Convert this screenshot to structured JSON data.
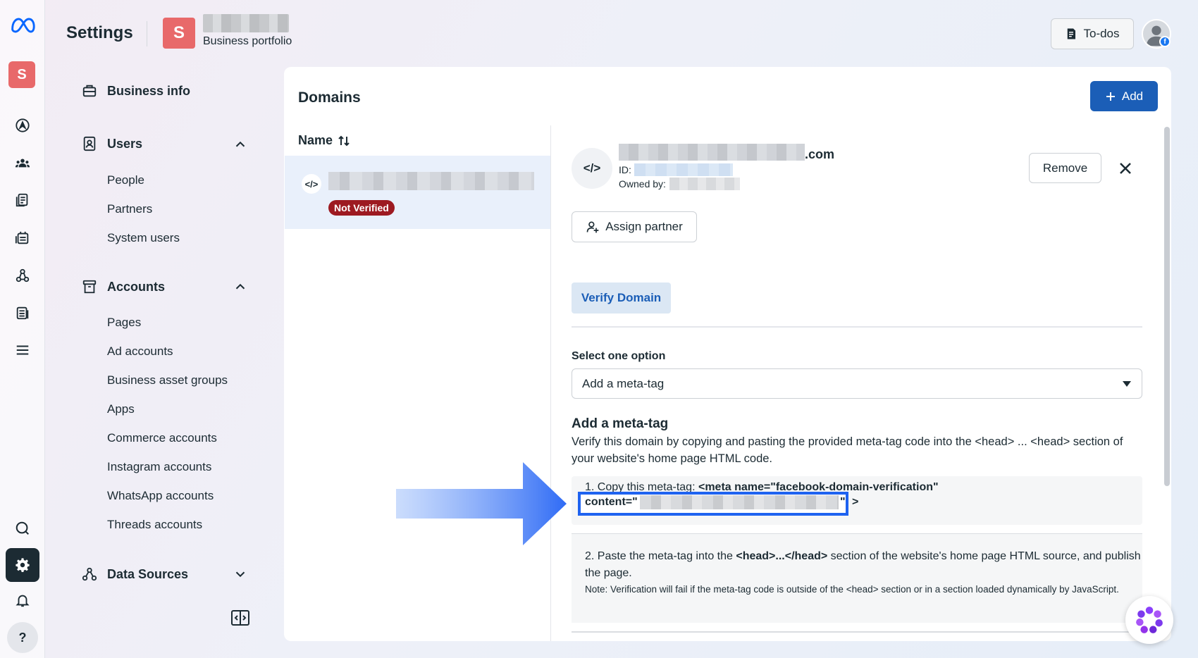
{
  "header": {
    "title": "Settings",
    "portfolio_initial": "S",
    "portfolio_subtitle": "Business portfolio",
    "todos_label": "To-dos"
  },
  "rail": {
    "account_initial": "S",
    "fb_badge": "f",
    "help_glyph": "?"
  },
  "sidebar": {
    "business_info": "Business info",
    "users": {
      "label": "Users",
      "items": [
        "People",
        "Partners",
        "System users"
      ]
    },
    "accounts": {
      "label": "Accounts",
      "items": [
        "Pages",
        "Ad accounts",
        "Business asset groups",
        "Apps",
        "Commerce accounts",
        "Instagram accounts",
        "WhatsApp accounts",
        "Threads accounts"
      ]
    },
    "data_sources": "Data Sources"
  },
  "main": {
    "title": "Domains",
    "add_label": "Add",
    "name_column": "Name",
    "row_badge": "Not Verified",
    "code_glyph": "</>"
  },
  "detail": {
    "domain_tld": ".com",
    "id_label": "ID:",
    "owned_by_label": "Owned by:",
    "remove_label": "Remove",
    "assign_partner_label": "Assign partner",
    "verify_tab": "Verify Domain",
    "select_label": "Select one option",
    "select_value": "Add a meta-tag",
    "meta_heading": "Add a meta-tag",
    "meta_description": "Verify this domain by copying and pasting the provided meta-tag code into the <head> ... <head> section of your website's home page HTML code.",
    "step1_prefix": "1. Copy this meta-tag: ",
    "step1_code": "<meta name=\"facebook-domain-verification\"",
    "step1_content": "content=\"",
    "step1_close": "\"",
    "step1_gt": ">",
    "step2_prefix": "2. Paste the meta-tag into the ",
    "step2_code": "<head>...</head>",
    "step2_suffix": " section of the website's home page HTML source, and publish the page.",
    "step2_note": "Note: Verification will fail if the meta-tag code is outside of the <head> section or in a section loaded dynamically by JavaScript."
  },
  "colors": {
    "primary": "#1b5eb7",
    "badge_red": "#9d1a21",
    "highlight_blue": "#1f63f0",
    "avatar": "#e8696a"
  }
}
